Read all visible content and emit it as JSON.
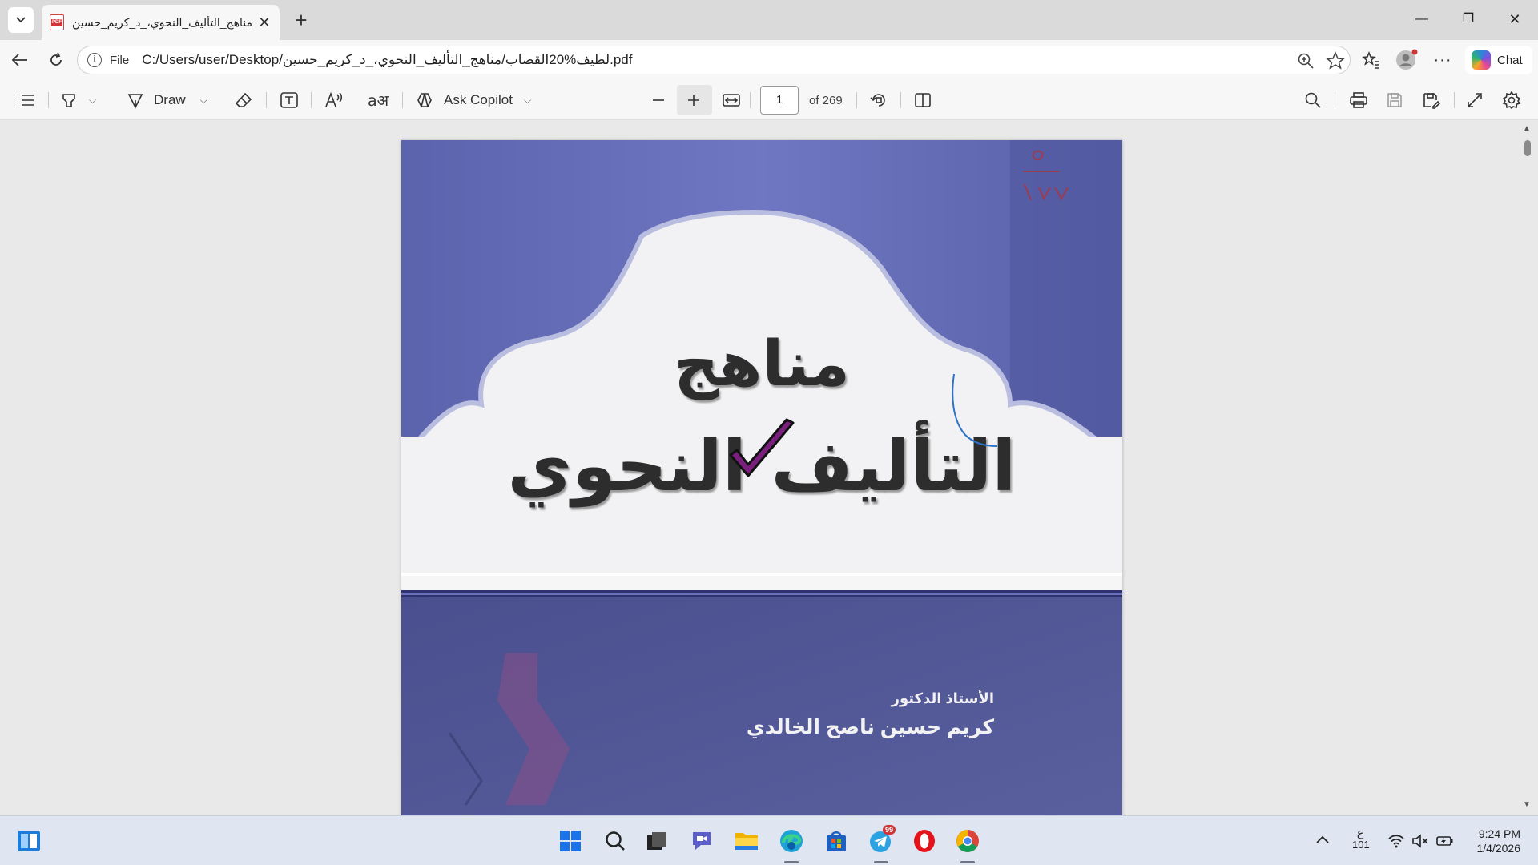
{
  "browser": {
    "tab_title": "مناهج_التأليف_النحوي،_د_كريم_حسين",
    "url_scheme_label": "File",
    "url": "C:/Users/user/Desktop/لطيف%20القصاب/مناهج_التأليف_النحوي،_د_كريم_حسين.pdf",
    "chat_label": "Chat"
  },
  "pdf_toolbar": {
    "draw_label": "Draw",
    "ask_copilot_label": "Ask Copilot",
    "page_number": "1",
    "page_total": "of 269"
  },
  "document": {
    "cover_title_line1": "مناهج",
    "cover_title_line2": "التأليف النحوي",
    "author_title": "الأستاذ الدكتور",
    "author_name": "كريم حسين ناصح الخالدي",
    "handwritten_note": "٥ / ١٧٧"
  },
  "taskbar": {
    "tray_ime_top": "ع",
    "tray_ime_bottom": "101",
    "time": "9:24 PM",
    "date": "1/4/2026",
    "telegram_badge": "99"
  },
  "colors": {
    "cover_top": "#6a70b8",
    "cover_band": "#f3f3f3",
    "cover_bottom": "#4e5596",
    "checkmark": "#7a1f7e"
  }
}
